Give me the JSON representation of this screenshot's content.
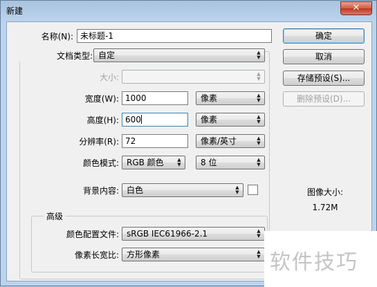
{
  "window": {
    "title": "新建",
    "close_glyph": "✕"
  },
  "fields": {
    "name_label": "名称(N):",
    "name_value": "未标题-1",
    "preset_label": "文档类型:",
    "preset_value": "自定",
    "size_label": "大小:",
    "size_value": "",
    "width_label": "宽度(W):",
    "width_value": "1000",
    "width_unit": "像素",
    "height_label": "高度(H):",
    "height_value": "600",
    "height_unit": "像素",
    "resolution_label": "分辨率(R):",
    "resolution_value": "72",
    "resolution_unit": "像素/英寸",
    "color_mode_label": "颜色模式:",
    "color_mode_value": "RGB 颜色",
    "bit_depth_value": "8 位",
    "background_label": "背景内容:",
    "background_value": "白色"
  },
  "advanced": {
    "title": "高级",
    "color_profile_label": "颜色配置文件:",
    "color_profile_value": "sRGB IEC61966-2.1",
    "pixel_aspect_label": "像素长宽比:",
    "pixel_aspect_value": "方形像素"
  },
  "buttons": {
    "ok": "确定",
    "cancel": "取消",
    "save_preset": "存储预设(S)...",
    "delete_preset": "删除预设(D)..."
  },
  "image_size": {
    "label": "图像大小:",
    "value": "1.72M"
  },
  "watermark": {
    "text": "软件技巧"
  },
  "colors": {
    "title_bar": "#bcd3ec",
    "dialog_bg": "#f0f0f0",
    "close_button": "#c1361f",
    "disabled_text": "#a0a0a0"
  }
}
